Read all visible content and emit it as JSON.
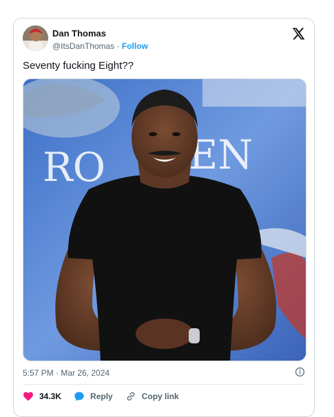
{
  "tweet": {
    "author_name": "Dan Thomas",
    "author_handle": "@ItsDanThomas",
    "separator": " · ",
    "follow_label": "Follow",
    "text": "Seventy fucking Eight??",
    "timestamp": "5:57 PM · Mar 26, 2024"
  },
  "actions": {
    "like_count": "34.3K",
    "reply_label": "Reply",
    "copy_link_label": "Copy link"
  },
  "icons": {
    "logo": "x-logo-icon",
    "like": "heart-icon",
    "reply": "speech-bubble-icon",
    "copy": "link-icon",
    "info": "info-icon"
  },
  "colors": {
    "accent": "#1d9bf0",
    "like": "#f91880",
    "text": "#0f1419",
    "muted": "#536471"
  }
}
